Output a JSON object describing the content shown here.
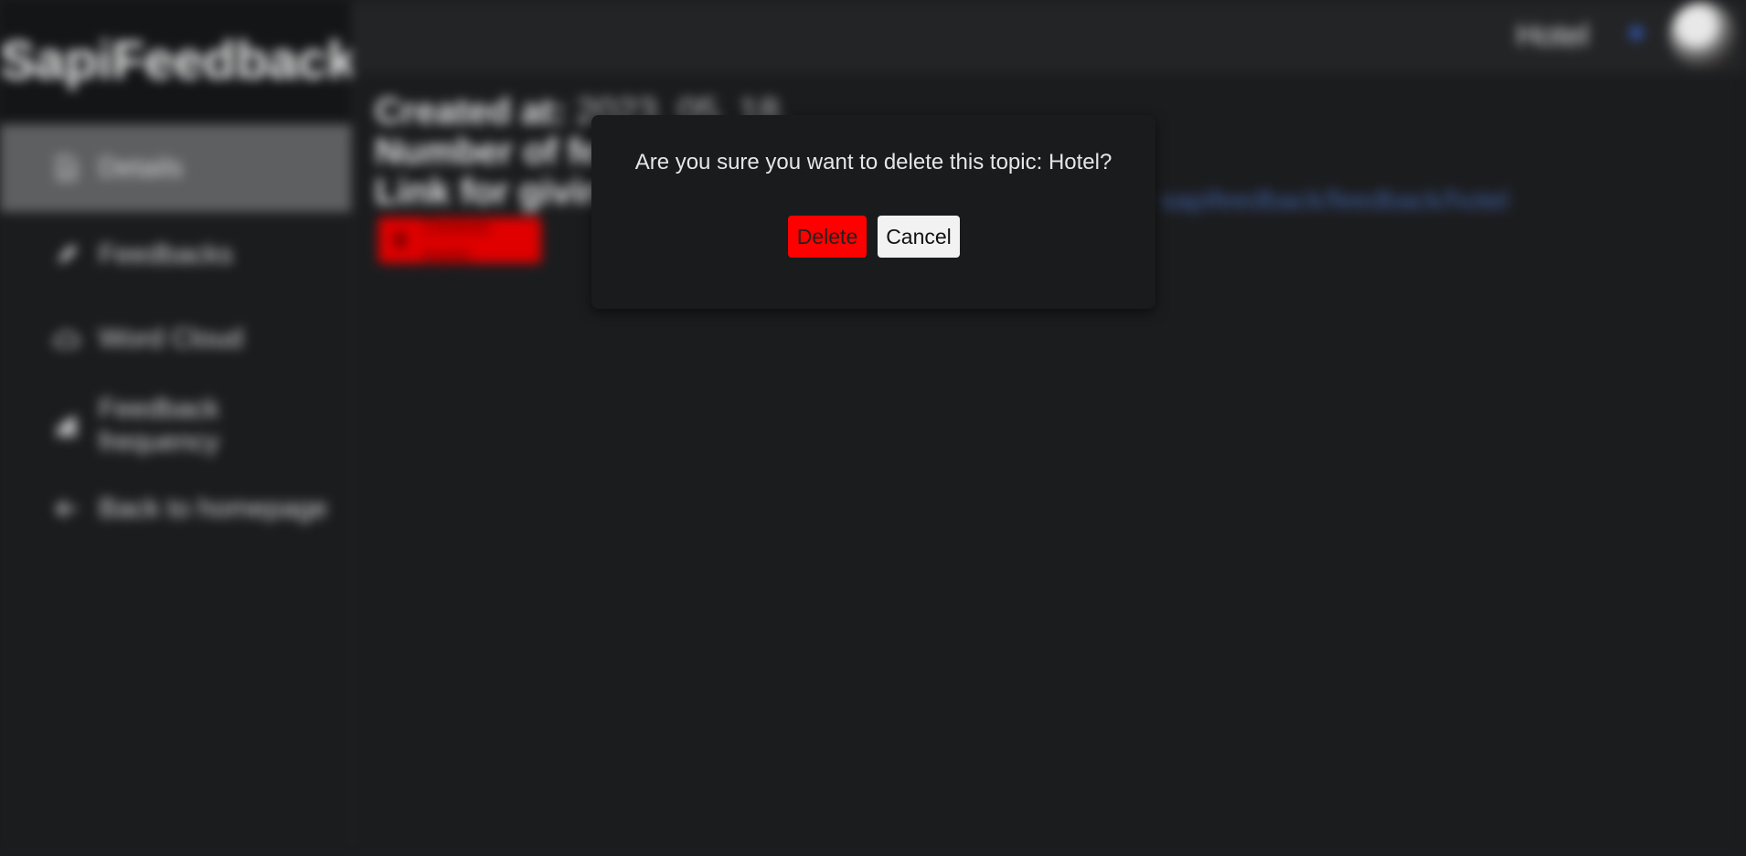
{
  "sidebar": {
    "brand": "SapiFeedback",
    "items": [
      {
        "label": "Details",
        "icon": "document-icon",
        "active": true
      },
      {
        "label": "Feedbacks",
        "icon": "edit-icon",
        "active": false
      },
      {
        "label": "Word Cloud",
        "icon": "cloud-icon",
        "active": false
      },
      {
        "label": "Feedback frequency",
        "icon": "bar-chart-icon",
        "active": false
      },
      {
        "label": "Back to homepage",
        "icon": "arrow-left-icon",
        "active": false
      }
    ]
  },
  "header": {
    "topic": "Hotel",
    "avatar": "user-avatar"
  },
  "details": {
    "created_label": "Created at:",
    "created_value": "2023. 05. 18.",
    "count_label": "Number of feedbacks:",
    "link_label": "Link for giving feedback:",
    "link_value": "sapifeedback/feedback/hotel",
    "delete_button": "Delete topic"
  },
  "modal": {
    "message": "Are you sure you want to delete this topic: Hotel?",
    "delete_label": "Delete",
    "cancel_label": "Cancel"
  },
  "colors": {
    "background": "#1b1c1e",
    "danger": "#ff0000",
    "sidebar_active": "#5e5f61"
  }
}
